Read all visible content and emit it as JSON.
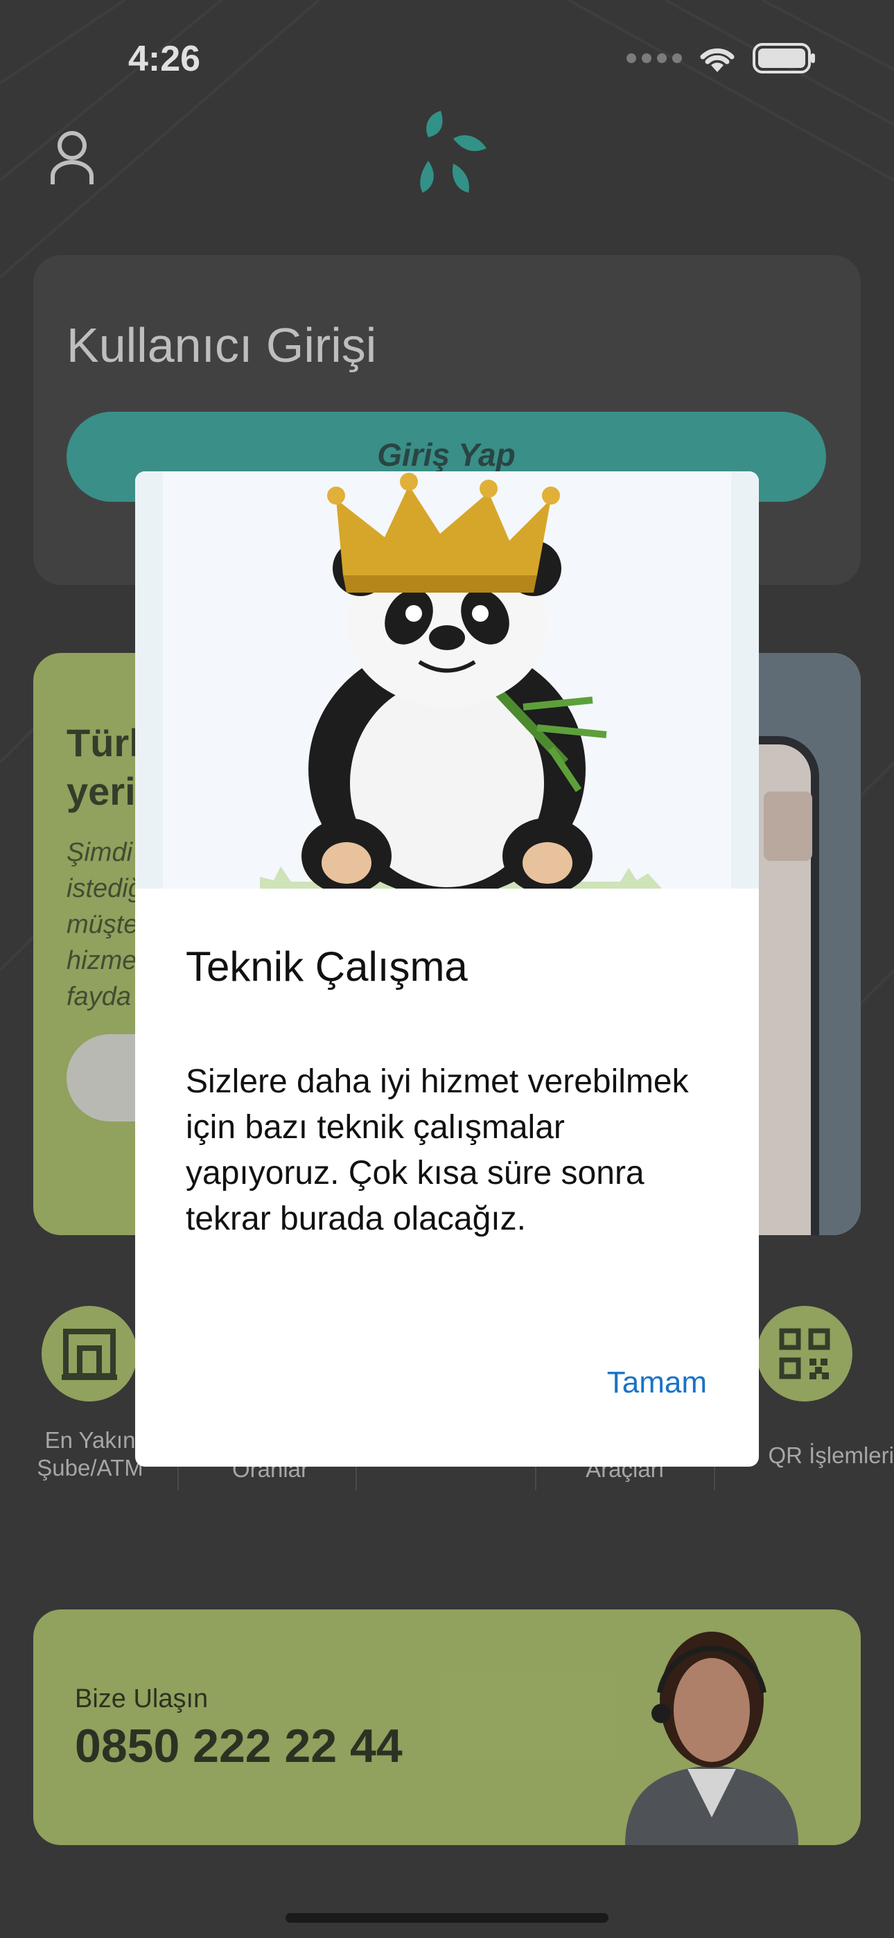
{
  "status_bar": {
    "time": "4:26"
  },
  "header": {
    "user_icon": "user-icon",
    "logo_icon": "bank-logo-icon"
  },
  "login": {
    "title": "Kullanıcı Girişi",
    "button_label": "Giriş Yap"
  },
  "promo": {
    "title": "Türk\nyeri",
    "text": "Şimdi\nistediğ\nmüşte\nhizme\nfayda"
  },
  "shortcuts": [
    {
      "icon": "building-icon",
      "label": "En Yakın\nŞube/ATM"
    },
    {
      "label": "Oranlar"
    },
    {
      "label": "Araçları"
    },
    {
      "icon": "qr-code-icon",
      "label": "QR İşlemleri"
    }
  ],
  "contact": {
    "label": "Bize Ulaşın",
    "phone": "0850 222 22 44"
  },
  "dialog": {
    "title": "Teknik Çalışma",
    "body": "Sizlere daha iyi hizmet verebilmek için bazı teknik çalışmalar yapıyoruz. Çok kısa süre sonra tekrar burada olacağız.",
    "ok_label": "Tamam"
  },
  "colors": {
    "background": "#3f3f3f",
    "accent_teal": "#43a39b",
    "accent_green": "#a6b86c",
    "link_blue": "#1a73c8"
  }
}
